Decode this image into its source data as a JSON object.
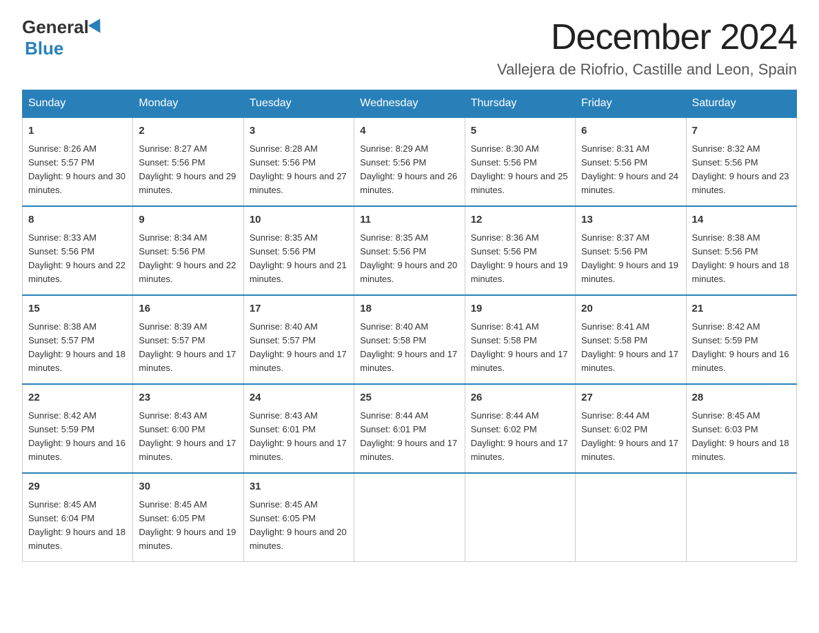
{
  "logo": {
    "general": "General",
    "blue": "Blue"
  },
  "header": {
    "title": "December 2024",
    "subtitle": "Vallejera de Riofrio, Castille and Leon, Spain"
  },
  "weekdays": [
    "Sunday",
    "Monday",
    "Tuesday",
    "Wednesday",
    "Thursday",
    "Friday",
    "Saturday"
  ],
  "weeks": [
    [
      {
        "day": "1",
        "sunrise": "8:26 AM",
        "sunset": "5:57 PM",
        "daylight": "9 hours and 30 minutes."
      },
      {
        "day": "2",
        "sunrise": "8:27 AM",
        "sunset": "5:56 PM",
        "daylight": "9 hours and 29 minutes."
      },
      {
        "day": "3",
        "sunrise": "8:28 AM",
        "sunset": "5:56 PM",
        "daylight": "9 hours and 27 minutes."
      },
      {
        "day": "4",
        "sunrise": "8:29 AM",
        "sunset": "5:56 PM",
        "daylight": "9 hours and 26 minutes."
      },
      {
        "day": "5",
        "sunrise": "8:30 AM",
        "sunset": "5:56 PM",
        "daylight": "9 hours and 25 minutes."
      },
      {
        "day": "6",
        "sunrise": "8:31 AM",
        "sunset": "5:56 PM",
        "daylight": "9 hours and 24 minutes."
      },
      {
        "day": "7",
        "sunrise": "8:32 AM",
        "sunset": "5:56 PM",
        "daylight": "9 hours and 23 minutes."
      }
    ],
    [
      {
        "day": "8",
        "sunrise": "8:33 AM",
        "sunset": "5:56 PM",
        "daylight": "9 hours and 22 minutes."
      },
      {
        "day": "9",
        "sunrise": "8:34 AM",
        "sunset": "5:56 PM",
        "daylight": "9 hours and 22 minutes."
      },
      {
        "day": "10",
        "sunrise": "8:35 AM",
        "sunset": "5:56 PM",
        "daylight": "9 hours and 21 minutes."
      },
      {
        "day": "11",
        "sunrise": "8:35 AM",
        "sunset": "5:56 PM",
        "daylight": "9 hours and 20 minutes."
      },
      {
        "day": "12",
        "sunrise": "8:36 AM",
        "sunset": "5:56 PM",
        "daylight": "9 hours and 19 minutes."
      },
      {
        "day": "13",
        "sunrise": "8:37 AM",
        "sunset": "5:56 PM",
        "daylight": "9 hours and 19 minutes."
      },
      {
        "day": "14",
        "sunrise": "8:38 AM",
        "sunset": "5:56 PM",
        "daylight": "9 hours and 18 minutes."
      }
    ],
    [
      {
        "day": "15",
        "sunrise": "8:38 AM",
        "sunset": "5:57 PM",
        "daylight": "9 hours and 18 minutes."
      },
      {
        "day": "16",
        "sunrise": "8:39 AM",
        "sunset": "5:57 PM",
        "daylight": "9 hours and 17 minutes."
      },
      {
        "day": "17",
        "sunrise": "8:40 AM",
        "sunset": "5:57 PM",
        "daylight": "9 hours and 17 minutes."
      },
      {
        "day": "18",
        "sunrise": "8:40 AM",
        "sunset": "5:58 PM",
        "daylight": "9 hours and 17 minutes."
      },
      {
        "day": "19",
        "sunrise": "8:41 AM",
        "sunset": "5:58 PM",
        "daylight": "9 hours and 17 minutes."
      },
      {
        "day": "20",
        "sunrise": "8:41 AM",
        "sunset": "5:58 PM",
        "daylight": "9 hours and 17 minutes."
      },
      {
        "day": "21",
        "sunrise": "8:42 AM",
        "sunset": "5:59 PM",
        "daylight": "9 hours and 16 minutes."
      }
    ],
    [
      {
        "day": "22",
        "sunrise": "8:42 AM",
        "sunset": "5:59 PM",
        "daylight": "9 hours and 16 minutes."
      },
      {
        "day": "23",
        "sunrise": "8:43 AM",
        "sunset": "6:00 PM",
        "daylight": "9 hours and 17 minutes."
      },
      {
        "day": "24",
        "sunrise": "8:43 AM",
        "sunset": "6:01 PM",
        "daylight": "9 hours and 17 minutes."
      },
      {
        "day": "25",
        "sunrise": "8:44 AM",
        "sunset": "6:01 PM",
        "daylight": "9 hours and 17 minutes."
      },
      {
        "day": "26",
        "sunrise": "8:44 AM",
        "sunset": "6:02 PM",
        "daylight": "9 hours and 17 minutes."
      },
      {
        "day": "27",
        "sunrise": "8:44 AM",
        "sunset": "6:02 PM",
        "daylight": "9 hours and 17 minutes."
      },
      {
        "day": "28",
        "sunrise": "8:45 AM",
        "sunset": "6:03 PM",
        "daylight": "9 hours and 18 minutes."
      }
    ],
    [
      {
        "day": "29",
        "sunrise": "8:45 AM",
        "sunset": "6:04 PM",
        "daylight": "9 hours and 18 minutes."
      },
      {
        "day": "30",
        "sunrise": "8:45 AM",
        "sunset": "6:05 PM",
        "daylight": "9 hours and 19 minutes."
      },
      {
        "day": "31",
        "sunrise": "8:45 AM",
        "sunset": "6:05 PM",
        "daylight": "9 hours and 20 minutes."
      },
      null,
      null,
      null,
      null
    ]
  ]
}
